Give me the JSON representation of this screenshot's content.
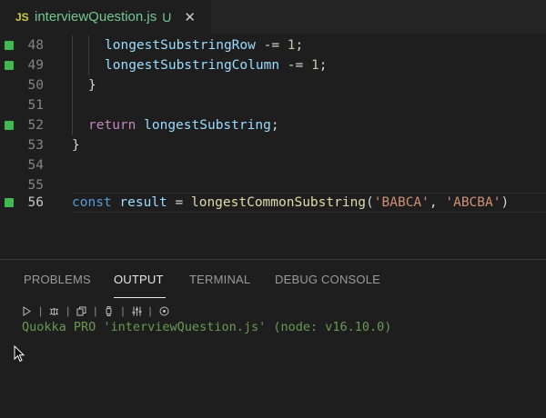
{
  "tab": {
    "icon_label": "JS",
    "file_name": "interviewQuestion.js",
    "status": "U",
    "close": "✕"
  },
  "editor": {
    "lines": [
      {
        "number": "48",
        "modified": true
      },
      {
        "number": "49",
        "modified": true
      },
      {
        "number": "50",
        "modified": false
      },
      {
        "number": "51",
        "modified": false
      },
      {
        "number": "52",
        "modified": true
      },
      {
        "number": "53",
        "modified": false
      },
      {
        "number": "54",
        "modified": false
      },
      {
        "number": "55",
        "modified": false
      },
      {
        "number": "56",
        "modified": true,
        "active": true
      }
    ],
    "code": {
      "l48_var": "longestSubstringRow",
      "l48_op": " -= ",
      "l48_num": "1",
      "l48_end": ";",
      "l49_var": "longestSubstringColumn",
      "l49_op": " -= ",
      "l49_num": "1",
      "l49_end": ";",
      "l50": "}",
      "l52_kw": "return",
      "l52_var": "longestSubstring",
      "l52_end": ";",
      "l53": "}",
      "l56_decl": "const",
      "l56_var": "result",
      "l56_eq": " = ",
      "l56_fn": "longestCommonSubstring",
      "l56_open": "(",
      "l56_str1": "'BABCA'",
      "l56_comma": ", ",
      "l56_str2": "'ABCBA'",
      "l56_close": ")"
    }
  },
  "panel": {
    "tabs": [
      {
        "label": "PROBLEMS"
      },
      {
        "label": "OUTPUT",
        "active": true
      },
      {
        "label": "TERMINAL"
      },
      {
        "label": "DEBUG CONSOLE"
      }
    ],
    "toolbar_separator": "|",
    "output": "Quokka PRO 'interviewQuestion.js' (node: v16.10.0)"
  },
  "colors": {
    "gutter_modified": "#3fb950",
    "output_text": "#6a9955",
    "file_modified": "#73c991"
  }
}
